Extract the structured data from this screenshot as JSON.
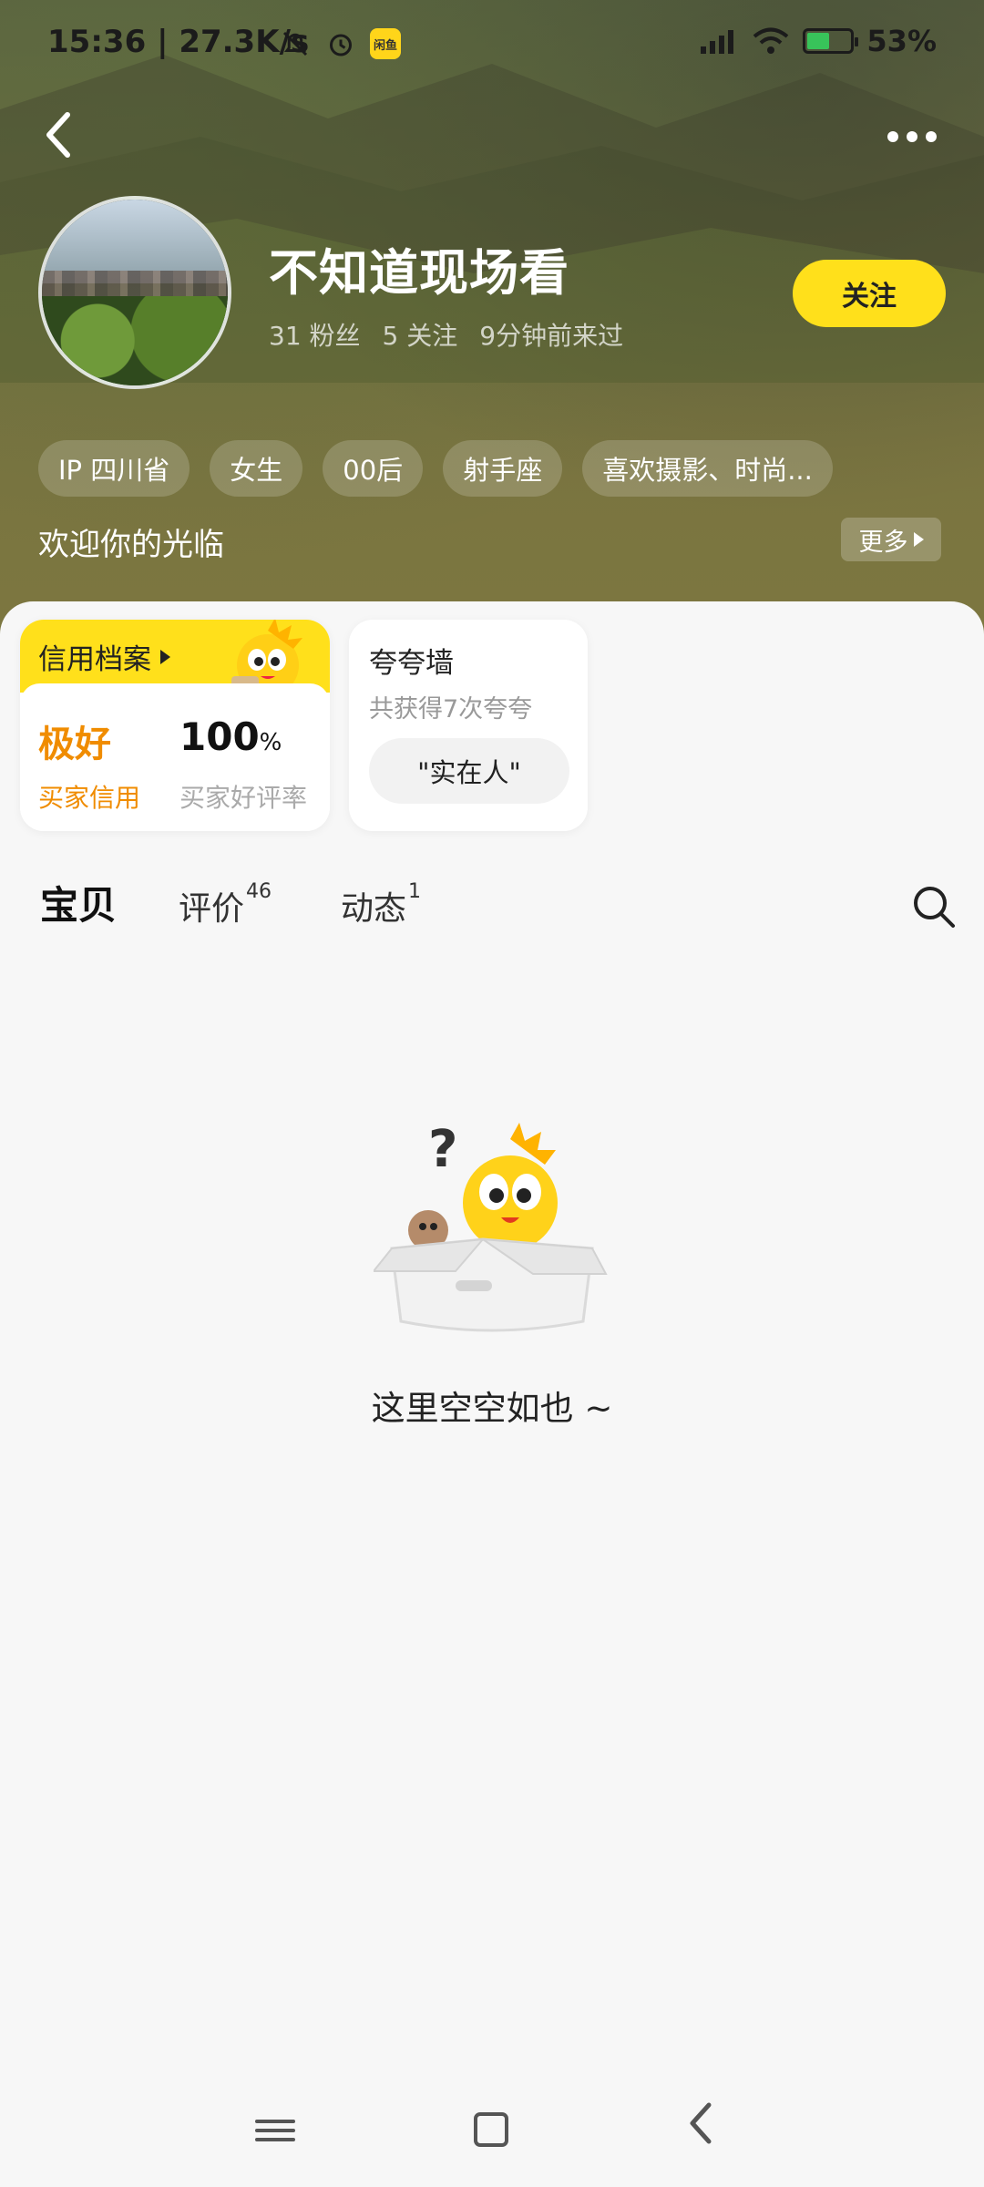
{
  "status_bar": {
    "time": "15:36",
    "net_speed": "27.3K/s",
    "app_badge": "闲鱼",
    "battery": "53%",
    "battery_level": 0.53
  },
  "profile": {
    "name": "不知道现场看",
    "fans": "31 粉丝",
    "following": "5 关注",
    "last_seen": "9分钟前来过",
    "follow_label": "关注",
    "tags": [
      "IP 四川省",
      "女生",
      "00后",
      "射手座",
      "喜欢摄影、时尚..."
    ],
    "welcome": "欢迎你的光临",
    "more_label": "更多"
  },
  "credit": {
    "title": "信用档案",
    "grade": "极好",
    "grade_label": "买家信用",
    "rate": "100",
    "rate_unit": "%",
    "rate_label": "买家好评率"
  },
  "praise": {
    "title": "夸夸墙",
    "count_text": "共获得7次夸夸",
    "top_tag": "\"实在人\""
  },
  "tabs": [
    {
      "label": "宝贝",
      "count": ""
    },
    {
      "label": "评价",
      "count": "46"
    },
    {
      "label": "动态",
      "count": "1"
    }
  ],
  "empty": {
    "text": "这里空空如也 ~"
  },
  "colors": {
    "accent": "#ffe01b",
    "credit_orange": "#f08c00"
  }
}
